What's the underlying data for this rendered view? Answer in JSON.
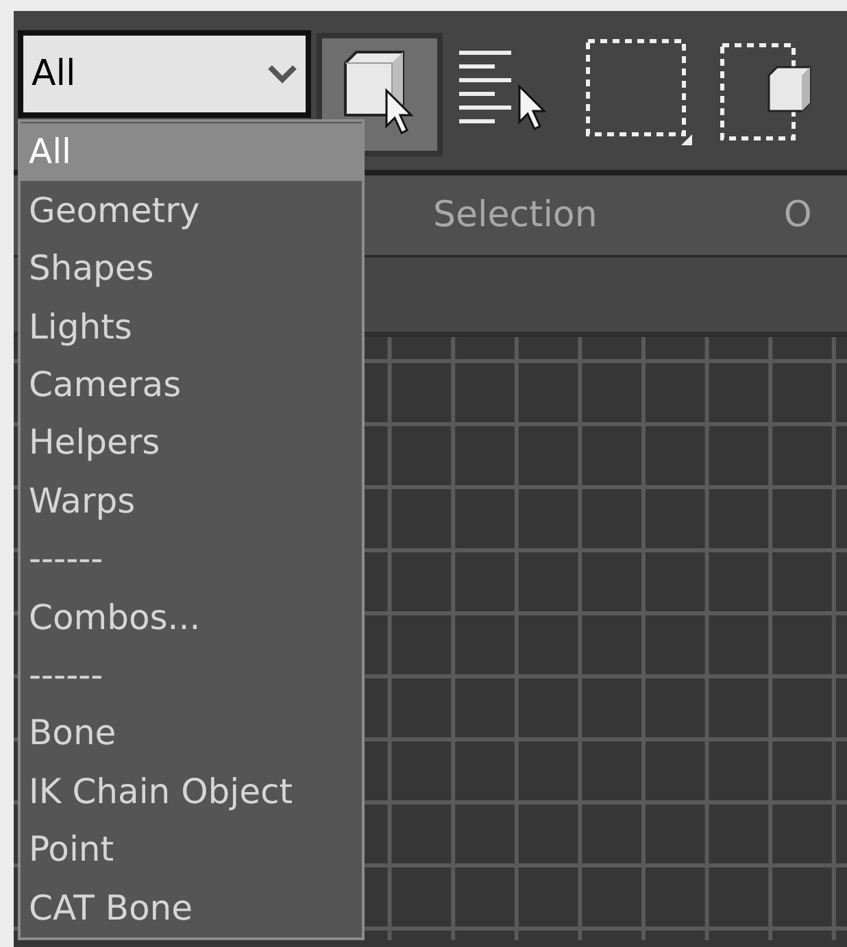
{
  "toolbar": {
    "filter_dropdown": {
      "value": "All"
    },
    "buttons": [
      {
        "kind": "select-object",
        "pressed": true
      },
      {
        "kind": "select-by-name",
        "pressed": false
      },
      {
        "kind": "rectangle-region",
        "pressed": false
      },
      {
        "kind": "window-crossing",
        "pressed": false
      }
    ]
  },
  "filter_menu": {
    "items": [
      {
        "label": "All",
        "selected": true
      },
      {
        "label": "Geometry",
        "selected": false
      },
      {
        "label": "Shapes",
        "selected": false
      },
      {
        "label": "Lights",
        "selected": false
      },
      {
        "label": "Cameras",
        "selected": false
      },
      {
        "label": "Helpers",
        "selected": false
      },
      {
        "label": "Warps",
        "selected": false
      },
      {
        "label": "------",
        "selected": false
      },
      {
        "label": "Combos...",
        "selected": false
      },
      {
        "label": "------",
        "selected": false
      },
      {
        "label": "Bone",
        "selected": false
      },
      {
        "label": "IK Chain Object",
        "selected": false
      },
      {
        "label": "Point",
        "selected": false
      },
      {
        "label": "CAT Bone",
        "selected": false
      }
    ]
  },
  "tabs": [
    {
      "label": "Selection"
    },
    {
      "label": "O"
    }
  ]
}
